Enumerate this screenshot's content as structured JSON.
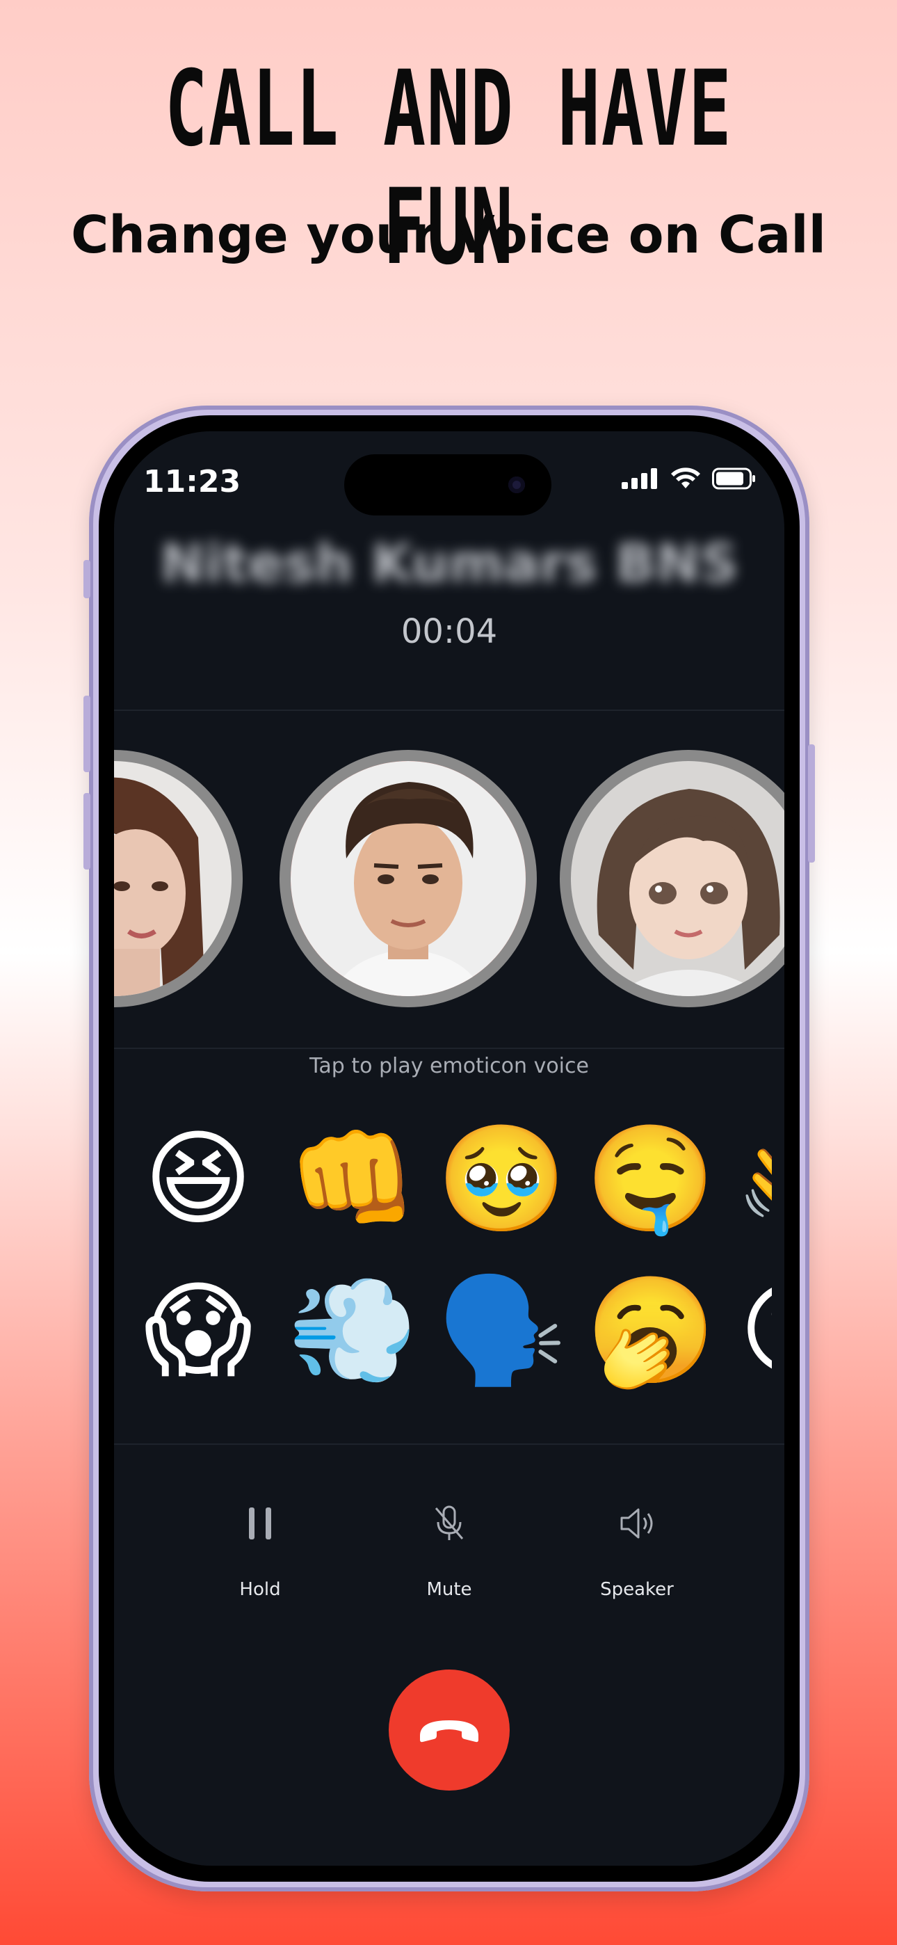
{
  "promo": {
    "headline": "CALL AND HAVE FUN",
    "subheadline": "Change your Voice on Call"
  },
  "status_bar": {
    "time": "11:23",
    "icons": [
      "cellular-signal-icon",
      "wifi-icon",
      "battery-icon"
    ]
  },
  "call": {
    "caller_name": "Nitesh Kumars BNS",
    "duration": "00:04"
  },
  "voice_avatars": [
    {
      "name": "female-avatar",
      "selected": false
    },
    {
      "name": "male-avatar",
      "selected": true
    },
    {
      "name": "girl-avatar",
      "selected": false
    }
  ],
  "emoticon_hint": "Tap to play emoticon voice",
  "emoticons_row1": [
    "😆",
    "👊",
    "🥹",
    "🤤",
    "👋"
  ],
  "emoticons_row2": [
    "😱",
    "💨",
    "🗣️",
    "🥱",
    "😮"
  ],
  "controls": {
    "hold_label": "Hold",
    "mute_label": "Mute",
    "speaker_label": "Speaker"
  },
  "colors": {
    "accent_red": "#ef3b2c",
    "screen_bg": "#10141b",
    "frame": "#c9bfe6"
  }
}
